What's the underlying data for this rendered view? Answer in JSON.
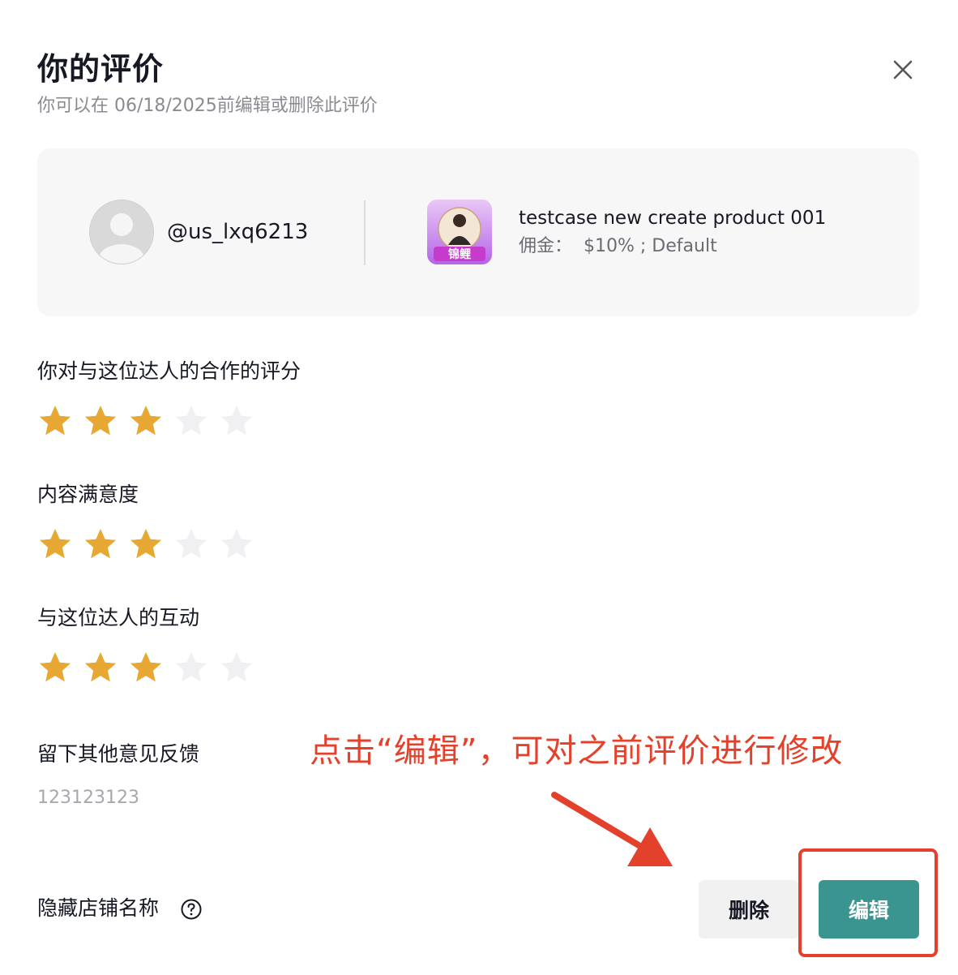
{
  "dialog": {
    "title": "你的评价",
    "subtitle": "你可以在 06/18/2025前编辑或删除此评价"
  },
  "creator": {
    "username": "@us_lxq6213"
  },
  "product": {
    "name": "testcase new create product 001",
    "commission_label": "佣金：",
    "commission_value": "$10% ; Default",
    "thumbnail_text": "锦鲤"
  },
  "ratings": [
    {
      "label": "你对与这位达人的合作的评分",
      "value": 3,
      "max": 5
    },
    {
      "label": "内容满意度",
      "value": 3,
      "max": 5
    },
    {
      "label": "与这位达人的互动",
      "value": 3,
      "max": 5
    }
  ],
  "feedback": {
    "label": "留下其他意见反馈",
    "text": "123123123"
  },
  "footer": {
    "hide_store_label": "隐藏店铺名称",
    "delete_label": "删除",
    "edit_label": "编辑"
  },
  "annotation": {
    "text": "点击“编辑”，可对之前评价进行修改",
    "color": "#e4412c"
  },
  "colors": {
    "star_filled": "#e6a833",
    "star_empty": "#f0f0f2",
    "edit_button": "#3a9590"
  },
  "icons": {
    "close": "close-icon",
    "help": "question-circle-icon",
    "star": "star-icon",
    "avatar": "default-avatar-icon"
  }
}
